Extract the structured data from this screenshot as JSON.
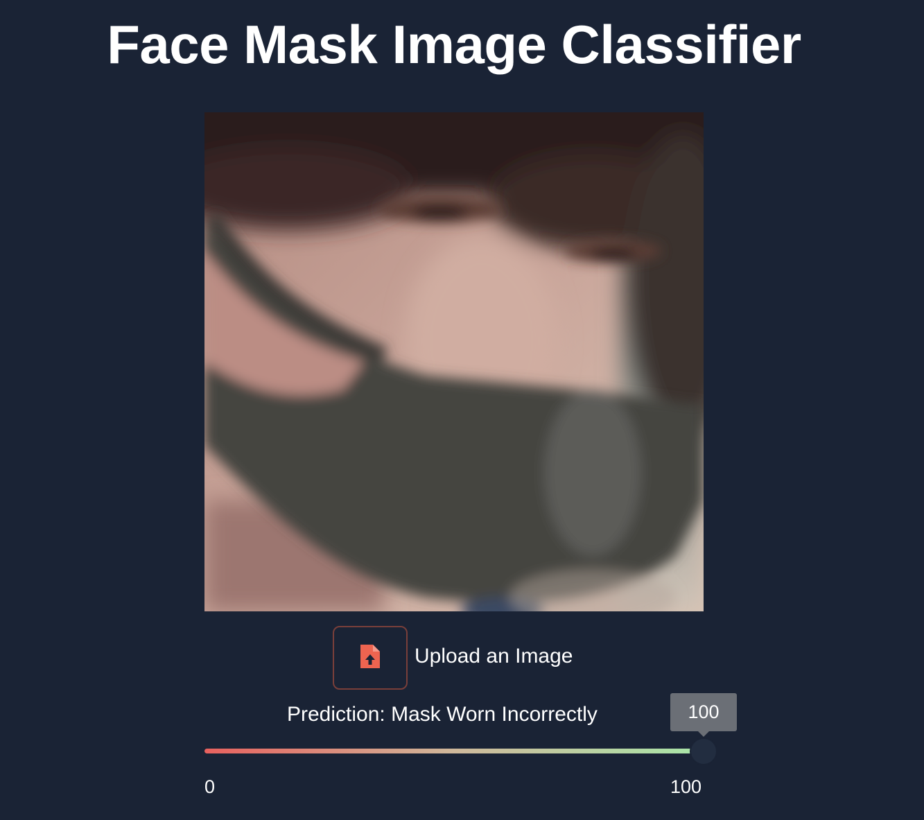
{
  "page": {
    "title": "Face Mask Image Classifier"
  },
  "upload": {
    "icon": "file-upload-icon",
    "label": "Upload an Image",
    "accent_color": "#ee6450"
  },
  "prediction": {
    "text": "Prediction: Mask Worn Incorrectly"
  },
  "slider": {
    "value": 100,
    "value_label": "100",
    "min_label": "0",
    "max_label": "100",
    "gradient_colors": [
      "#e8615e",
      "#cfb89b",
      "#a8e6a8"
    ]
  },
  "colors": {
    "background": "#1a2335"
  }
}
